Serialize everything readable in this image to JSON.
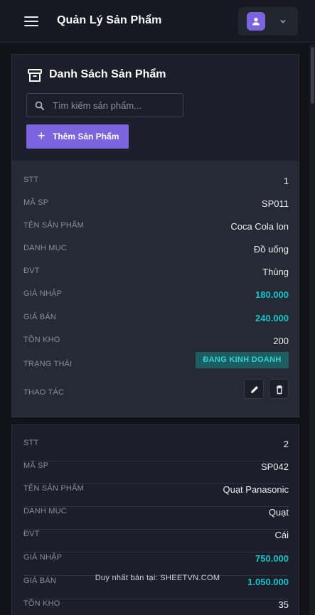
{
  "header": {
    "title": "Quản Lý Sản Phẩm",
    "menu_icon": "hamburger-menu-icon",
    "user_icon": "user-icon",
    "accent_color": "#7b64dd"
  },
  "panel": {
    "title": "Danh Sách Sản Phẩm",
    "title_icon": "archive-box-icon",
    "search_placeholder": "Tìm kiếm sản phẩm...",
    "add_button": "Thêm Sản Phẩm"
  },
  "labels": {
    "stt": "STT",
    "code": "MÃ SP",
    "name": "TÊN SẢN PHẨM",
    "category": "DANH MỤC",
    "unit": "ĐVT",
    "buy_price": "GIÁ NHẬP",
    "sell_price": "GIÁ BÁN",
    "stock": "TỒN KHO",
    "status": "TRẠNG THÁI",
    "actions": "THAO TÁC"
  },
  "products": [
    {
      "stt": "1",
      "code": "SP011",
      "name": "Coca Cola lon",
      "category": "Đồ uống",
      "unit": "Thùng",
      "buy_price": "180.000",
      "sell_price": "240.000",
      "stock": "200",
      "status": "ĐANG KINH DOANH"
    },
    {
      "stt": "2",
      "code": "SP042",
      "name": "Quạt Panasonic",
      "category": "Quạt",
      "unit": "Cái",
      "buy_price": "750.000",
      "sell_price": "1.050.000",
      "stock": "35"
    }
  ],
  "status_color": "#16c3cc",
  "watermark": "Duy nhất bán tại: SHEETVN.COM"
}
